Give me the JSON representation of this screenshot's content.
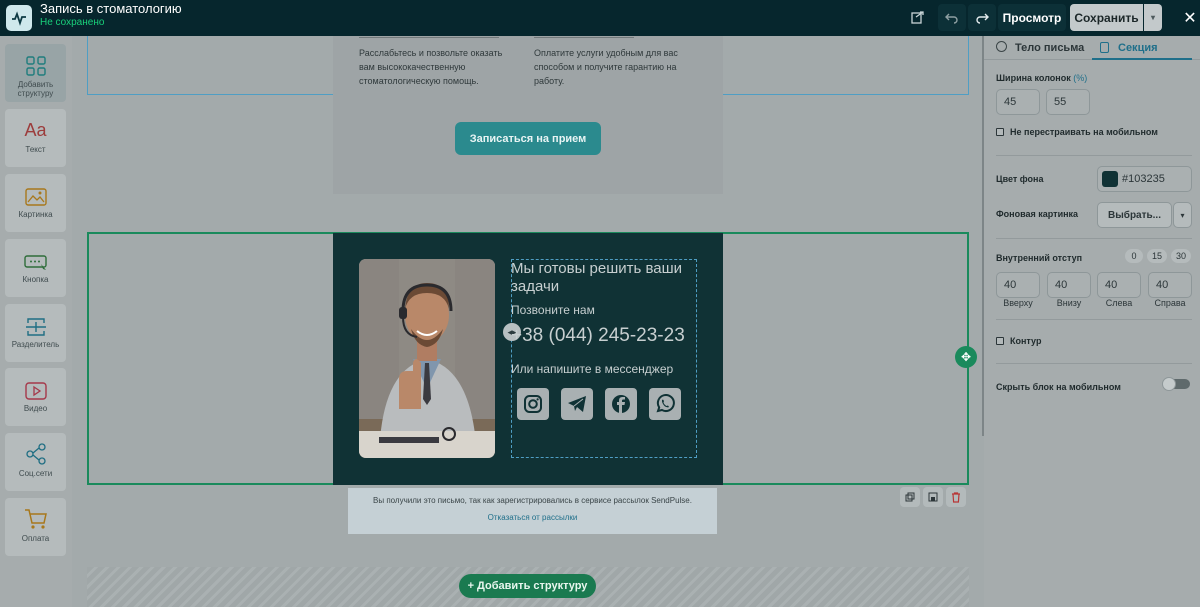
{
  "app": {
    "title": "Запись в стоматологию",
    "save_status": "Не сохранено",
    "preview_label": "Просмотр",
    "save_label": "Сохранить"
  },
  "sidebar": {
    "items": [
      {
        "label": "Добавить структуру",
        "icon": "grid-icon"
      },
      {
        "label": "Текст",
        "icon": "text-icon"
      },
      {
        "label": "Картинка",
        "icon": "image-icon"
      },
      {
        "label": "Кнопка",
        "icon": "button-icon"
      },
      {
        "label": "Разделитель",
        "icon": "divider-icon"
      },
      {
        "label": "Видео",
        "icon": "video-icon"
      },
      {
        "label": "Соц.сети",
        "icon": "share-icon"
      },
      {
        "label": "Оплата",
        "icon": "cart-icon"
      }
    ]
  },
  "canvas": {
    "section1": {
      "col1_text": "Расслабьтесь и позвольте оказать вам высококачественную стоматологическую помощь.",
      "col2_text": "Оплатите услуги удобным для вас способом и получите гарантию на работу.",
      "cta_label": "Записаться на прием"
    },
    "contact": {
      "heading": "Мы готовы решить ваши задачи",
      "call_label": "Позвоните нам",
      "phone": "+38 (044) 245-23-23",
      "messenger_label": "Или напишите в мессенджер",
      "socials": [
        "instagram-icon",
        "telegram-icon",
        "facebook-icon",
        "whatsapp-icon"
      ]
    },
    "footer": {
      "text": "Вы получили это письмо, так как зарегистрировались в сервисе рассылок SendPulse.",
      "unsubscribe": "Отказаться от рассылки"
    },
    "add_structure_label": "+ Добавить структуру"
  },
  "panel": {
    "tabs": [
      "Тело письма",
      "Секция"
    ],
    "column_width_label": "Ширина колонок",
    "column_width_unit": "(%)",
    "col_width_values": [
      "45",
      "55"
    ],
    "no_rearrange_label": "Не перестраивать на мобильном",
    "bg_color_label": "Цвет фона",
    "bg_color_value": "#103235",
    "bg_image_label": "Фоновая картинка",
    "choose_label": "Выбрать...",
    "padding_label": "Внутренний отступ",
    "padding_presets": [
      "0",
      "15",
      "30"
    ],
    "padding_values": [
      "40",
      "40",
      "40",
      "40"
    ],
    "padding_sides": [
      "Вверху",
      "Внизу",
      "Слева",
      "Справа"
    ],
    "outline_label": "Контур",
    "hide_mobile_label": "Скрыть блок на мобильном"
  },
  "colors": {
    "topbar": "#06262d",
    "accent_green": "#1a8a5c",
    "dark_section": "#103235"
  }
}
